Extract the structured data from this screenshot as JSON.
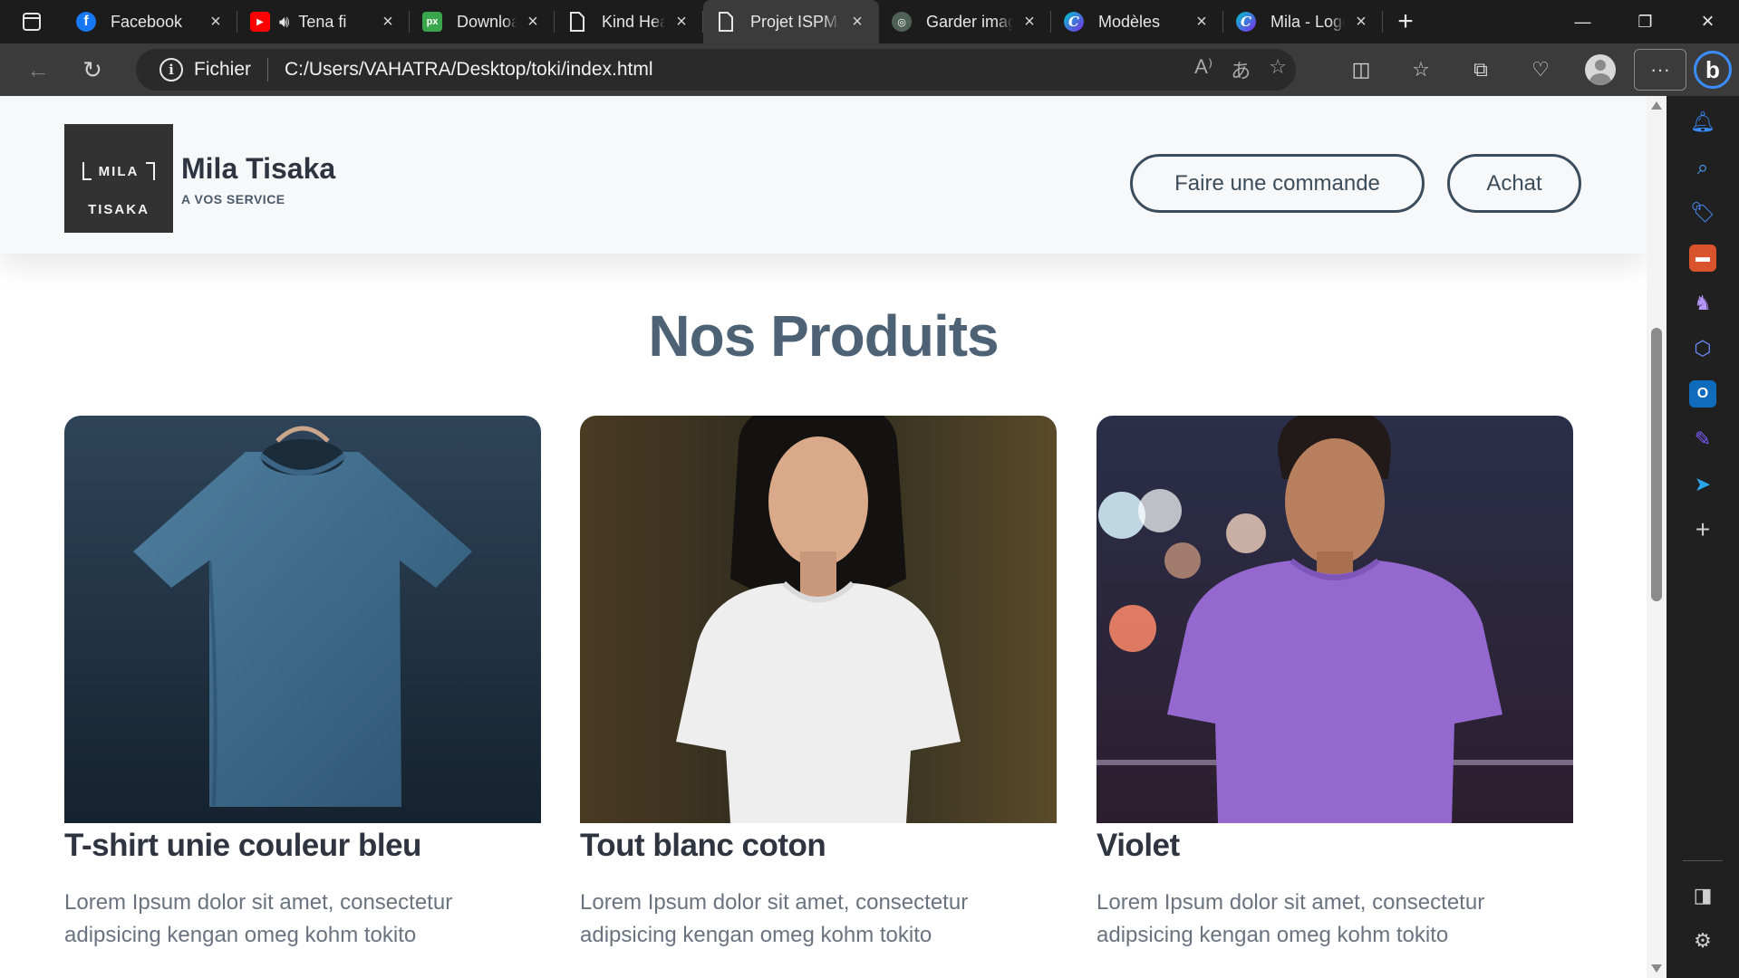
{
  "browser": {
    "tabs": [
      {
        "title": "Facebook",
        "icon": "facebook-icon",
        "color": "#1877f2",
        "glyph": "f"
      },
      {
        "title": "Tena fi",
        "icon": "youtube-icon",
        "color": "#ff0000",
        "glyph": "▶",
        "audio": true
      },
      {
        "title": "Download A",
        "icon": "pixlr-icon",
        "color": "#3aa64c",
        "glyph": "px"
      },
      {
        "title": "Kind Heart C",
        "icon": "document-icon",
        "color": "#1c1c1c",
        "glyph": ""
      },
      {
        "title": "Projet ISPM",
        "icon": "document-icon",
        "color": "#3b3b3b",
        "glyph": "",
        "active": true
      },
      {
        "title": "Garder imag",
        "icon": "chatgpt-icon",
        "color": "#5a6b60",
        "glyph": "◎"
      },
      {
        "title": "Modèles",
        "icon": "canva-icon",
        "color": "#5b5bd6",
        "glyph": "C"
      },
      {
        "title": "Mila - Logo",
        "icon": "canva-icon",
        "color": "#3a7bd5",
        "glyph": "C"
      }
    ],
    "address": {
      "scheme_label": "Fichier",
      "url": "C:/Users/VAHATRA/Desktop/toki/index.html"
    }
  },
  "site": {
    "brand": {
      "logo_line1": "MILA",
      "logo_line2": "TISAKA",
      "name": "Mila Tisaka",
      "tagline": "A VOS SERVICE"
    },
    "nav": {
      "order_label": "Faire une commande",
      "buy_label": "Achat"
    },
    "section_title": "Nos Produits",
    "products": [
      {
        "title": "T-shirt unie couleur bleu",
        "description": "Lorem Ipsum dolor sit amet, consectetur adipsicing kengan omeg kohm tokito",
        "image": "blue-tshirt-on-hanger"
      },
      {
        "title": "Tout blanc coton",
        "description": "Lorem Ipsum dolor sit amet, consectetur adipsicing kengan omeg kohm tokito",
        "image": "woman-in-white-tshirt"
      },
      {
        "title": "Violet",
        "description": "Lorem Ipsum dolor sit amet, consectetur adipsicing kengan omeg kohm tokito",
        "image": "man-in-purple-tshirt"
      }
    ]
  },
  "colors": {
    "accent": "#3b4d5c",
    "title": "#4d6275",
    "header_bg": "#f7f8f9"
  }
}
